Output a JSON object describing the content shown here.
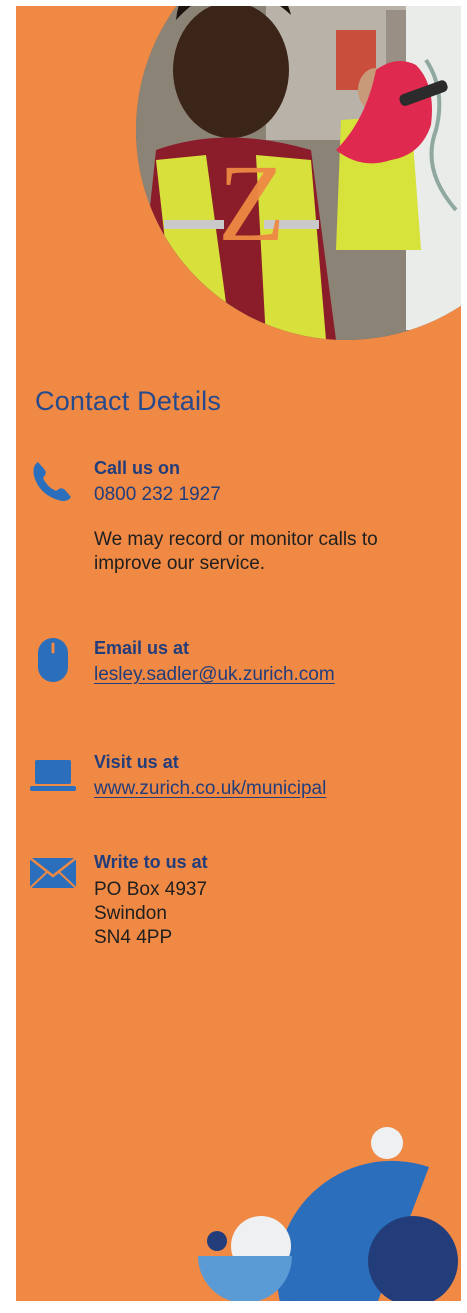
{
  "heading": "Contact Details",
  "contacts": {
    "phone": {
      "label": "Call us on",
      "value": "0800 232 1927",
      "note": "We may record or monitor calls to improve our service."
    },
    "email": {
      "label": "Email us at",
      "value": "lesley.sadler@uk.zurich.com"
    },
    "web": {
      "label": "Visit us at",
      "value": "www.zurich.co.uk/municipal"
    },
    "post": {
      "label": "Write to us at",
      "lines": [
        "PO Box 4937",
        "Swindon",
        "SN4 4PP"
      ]
    }
  },
  "icons": {
    "phone": "phone-icon",
    "email": "mouse-icon",
    "web": "laptop-icon",
    "post": "envelope-icon"
  },
  "colors": {
    "background": "#ef8944",
    "heading": "#274a8c",
    "label": "#233d7b",
    "icon": "#2a6ebc",
    "shape_blue": "#2a6ebc",
    "shape_navy": "#233d7b",
    "shape_light_blue": "#5b9bd5",
    "shape_white": "#eef0f2"
  }
}
